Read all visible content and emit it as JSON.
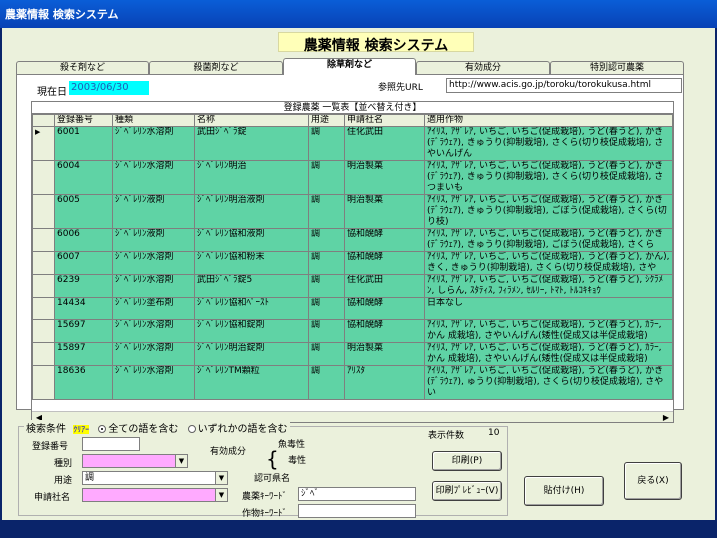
{
  "window": {
    "title": "農薬情報  検索システム"
  },
  "app": {
    "title": "農薬情報  検索システム"
  },
  "tabs": [
    {
      "label": "殺そ剤など"
    },
    {
      "label": "殺菌剤など"
    },
    {
      "label": "除草剤など",
      "active": true
    },
    {
      "label": "有効成分"
    },
    {
      "label": "特別認可農薬"
    }
  ],
  "header": {
    "date_label": "現在日",
    "date_value": "2003/06/30",
    "url_label": "参照先URL",
    "url_value": "http://www.acis.go.jp/toroku/torokukusa.html"
  },
  "grid": {
    "caption": "登録農薬  一覧表【並べ替え付き】",
    "columns": [
      "登録番号",
      "種類",
      "名称",
      "用途",
      "申請社名",
      "適用作物"
    ],
    "rows": [
      {
        "no": "6001",
        "type": "ｼﾞﾍﾞﾚﾘﾝ水溶剤",
        "name": "武田ｼﾞﾍﾞﾗ錠",
        "use": "調",
        "company": "住化武田",
        "crops": "ｱｲﾘｽ, ｱｻﾞﾚｱ, いちご, いちご(促成栽培), うど(春うど), かき(ﾃﾞﾗｳｪｱ), きゅうり(抑制栽培), さくら(切り枝促成栽培), さやいんげん",
        "selected": true
      },
      {
        "no": "6004",
        "type": "ｼﾞﾍﾞﾚﾘﾝ水溶剤",
        "name": "ｼﾞﾍﾞﾚﾘﾝ明治",
        "use": "調",
        "company": "明治製菓",
        "crops": "ｱｲﾘｽ, ｱｻﾞﾚｱ, いちご, いちご(促成栽培), うど(春うど), かき(ﾃﾞﾗｳｪｱ), きゅうり(抑制栽培), さくら(切り枝促成栽培), さつまいも"
      },
      {
        "no": "6005",
        "type": "ｼﾞﾍﾞﾚﾘﾝ液剤",
        "name": "ｼﾞﾍﾞﾚﾘﾝ明治液剤",
        "use": "調",
        "company": "明治製菓",
        "crops": "ｱｲﾘｽ, ｱｻﾞﾚｱ, いちご, いちご(促成栽培), うど(春うど), かき(ﾃﾞﾗｳｪｱ), きゅうり(抑制栽培), ごぼう(促成栽培), さくら(切り枝)"
      },
      {
        "no": "6006",
        "type": "ｼﾞﾍﾞﾚﾘﾝ液剤",
        "name": "ｼﾞﾍﾞﾚﾘﾝ協和液剤",
        "use": "調",
        "company": "協和醗酵",
        "crops": "ｱｲﾘｽ, ｱｻﾞﾚｱ, いちご, いちご(促成栽培), うど(春うど), かき(ﾃﾞﾗｳｪｱ), きゅうり(抑制栽培), ごぼう(促成栽培), さくら"
      },
      {
        "no": "6007",
        "type": "ｼﾞﾍﾞﾚﾘﾝ水溶剤",
        "name": "ｼﾞﾍﾞﾚﾘﾝ協和粉末",
        "use": "調",
        "company": "協和醗酵",
        "crops": "ｱｲﾘｽ, ｱｻﾞﾚｱ, いちご, いちご(促成栽培), うど(春うど), かん), きく, きゅうり(抑制栽培), さくら(切り枝促成栽培), さや"
      },
      {
        "no": "6239",
        "type": "ｼﾞﾍﾞﾚﾘﾝ水溶剤",
        "name": "武田ｼﾞﾍﾞﾗ錠5",
        "use": "調",
        "company": "住化武田",
        "crops": "ｱｲﾘｽ, ｱｻﾞﾚｱ, いちご, いちご(促成栽培), うど(春うど), ｼｸﾗﾒﾝ, しらん, ｽﾀﾃｨｽ, ﾌｨﾗﾒﾝ, ｾﾙﾘｰ, ﾄﾏﾄ, ﾄﾙｺｷｷｮｳ"
      },
      {
        "no": "14434",
        "type": "ｼﾞﾍﾞﾚﾘﾝ塗布剤",
        "name": "ｼﾞﾍﾞﾚﾘﾝ協和ﾍﾟｰｽﾄ",
        "use": "調",
        "company": "協和醗酵",
        "crops": "日本なし"
      },
      {
        "no": "15697",
        "type": "ｼﾞﾍﾞﾚﾘﾝ水溶剤",
        "name": "ｼﾞﾍﾞﾚﾘﾝ協和錠剤",
        "use": "調",
        "company": "協和醗酵",
        "crops": "ｱｲﾘｽ, ｱｻﾞﾚｱ, いちご, いちご(促成栽培), うど(春うど), ｶﾗｰ, かん 成栽培), さやいんげん(矮性(促成又は半促成栽培)"
      },
      {
        "no": "15897",
        "type": "ｼﾞﾍﾞﾚﾘﾝ水溶剤",
        "name": "ｼﾞﾍﾞﾚﾘﾝ明治錠剤",
        "use": "調",
        "company": "明治製菓",
        "crops": "ｱｲﾘｽ, ｱｻﾞﾚｱ, いちご, いちご(促成栽培), うど(春うど), ｶﾗｰ, かん 成栽培), さやいんげん(矮性(促成又は半促成栽培)"
      },
      {
        "no": "18636",
        "type": "ｼﾞﾍﾞﾚﾘﾝ水溶剤",
        "name": "ｼﾞﾍﾞﾚﾘﾝTM顆粒",
        "use": "調",
        "company": "ｱﾘｽﾀ",
        "crops": "ｱｲﾘｽ, ｱｻﾞﾚｱ, いちご, いちご(促成栽培), うど(春うど), かき(ﾃﾞﾗｳｪｱ), ゅうり(抑制栽培), さくら(切り枝促成栽培), さやい"
      }
    ]
  },
  "search": {
    "label": "検索条件",
    "clear_label": "ｸﾘｱｰ",
    "radio_all": "全ての語を含む",
    "radio_any": "いずれかの語を含む",
    "reg_no_label": "登録番号",
    "type_label": "種別",
    "use_label": "用途",
    "use_value": "調",
    "company_label": "申請社名",
    "active_ingredient_label": "有効成分",
    "fish_toxicity_label": "魚毒性",
    "toxicity_label": "毒性",
    "approved_pref_label": "認可県名",
    "pesticide_keyword_label": "農薬ｷｰﾜｰﾄﾞ",
    "pesticide_keyword_value": "ｼﾞﾍﾞ",
    "crop_keyword_label": "作物ｷｰﾜｰﾄﾞ",
    "count_label": "表示件数",
    "count_value": "10"
  },
  "buttons": {
    "print": "印刷(P)",
    "print_preview": "印刷ﾌﾟﾚﾋﾞｭｰ(V)",
    "paste": "貼付け(H)",
    "back": "戻る(X)"
  },
  "colors": {
    "row_bg": "#5fd3a5",
    "window_bg": "#ebf1dc",
    "title_yellow": "#ffffb8",
    "pink_field": "#ffaaff",
    "date_cyan": "#00ffff"
  }
}
